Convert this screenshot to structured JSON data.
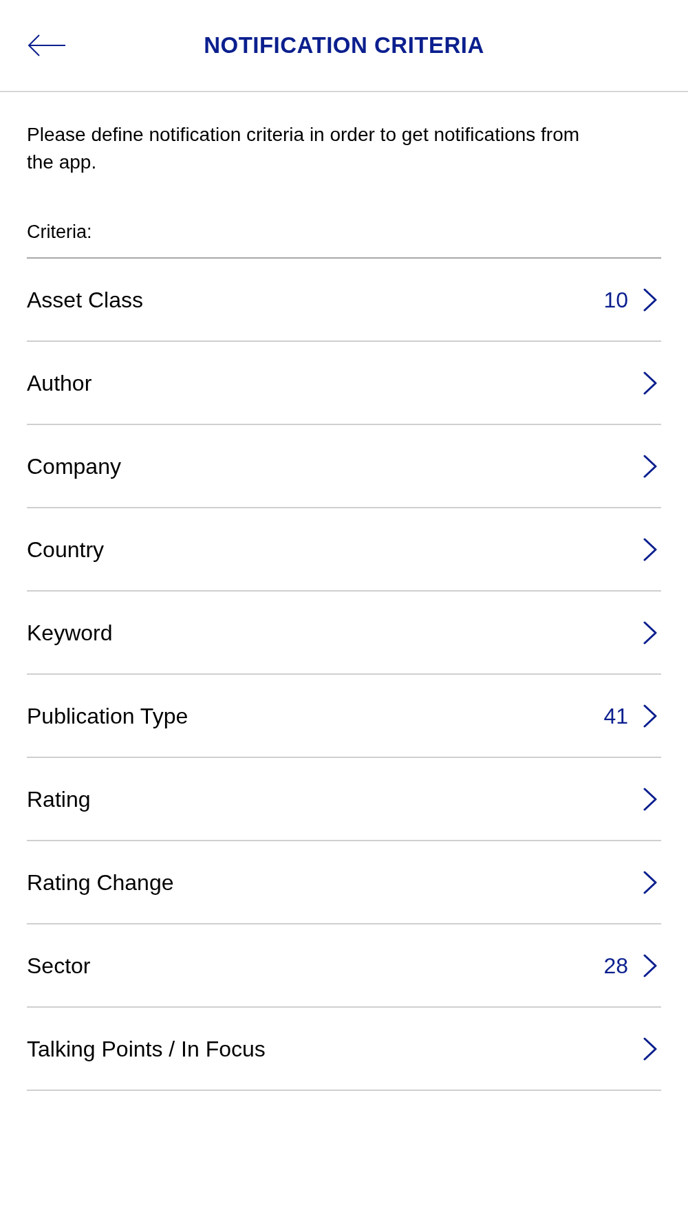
{
  "header": {
    "title": "NOTIFICATION CRITERIA"
  },
  "intro": "Please define notification criteria in order to get notifications from the app.",
  "criteria_label": "Criteria:",
  "criteria": [
    {
      "label": "Asset Class",
      "count": "10"
    },
    {
      "label": "Author"
    },
    {
      "label": "Company"
    },
    {
      "label": "Country"
    },
    {
      "label": "Keyword"
    },
    {
      "label": "Publication Type",
      "count": "41"
    },
    {
      "label": "Rating"
    },
    {
      "label": "Rating Change"
    },
    {
      "label": "Sector",
      "count": "28"
    },
    {
      "label": "Talking Points / In Focus"
    }
  ]
}
